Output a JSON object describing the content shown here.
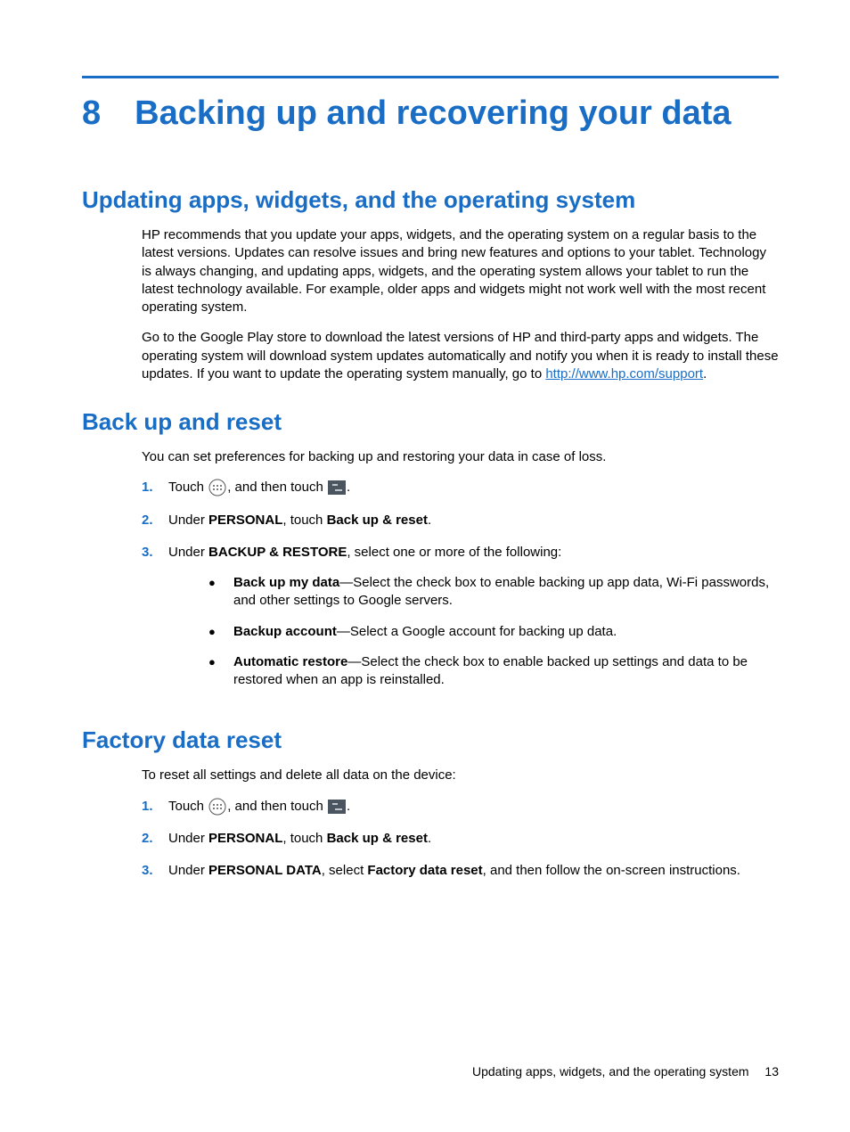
{
  "chapter": {
    "number": "8",
    "title": "Backing up and recovering your data"
  },
  "section1": {
    "heading": "Updating apps, widgets, and the operating system",
    "p1": "HP recommends that you update your apps, widgets, and the operating system on a regular basis to the latest versions. Updates can resolve issues and bring new features and options to your tablet. Technology is always changing, and updating apps, widgets, and the operating system allows your tablet to run the latest technology available. For example, older apps and widgets might not work well with the most recent operating system.",
    "p2a": "Go to the Google Play store to download the latest versions of HP and third-party apps and widgets. The operating system will download system updates automatically and notify you when it is ready to install these updates. If you want to update the operating system manually, go to ",
    "link": "http://www.hp.com/support",
    "p2b": "."
  },
  "section2": {
    "heading": "Back up and reset",
    "intro": "You can set preferences for backing up and restoring your data in case of loss.",
    "steps": {
      "s1a": "Touch ",
      "s1b": ", and then touch ",
      "s1c": ".",
      "s2a": "Under ",
      "s2b": "PERSONAL",
      "s2c": ", touch ",
      "s2d": "Back up & reset",
      "s2e": ".",
      "s3a": "Under ",
      "s3b": "BACKUP & RESTORE",
      "s3c": ", select one or more of the following:",
      "b1a": "Back up my data",
      "b1b": "—Select the check box to enable backing up app data, Wi-Fi passwords, and other settings to Google servers.",
      "b2a": "Backup account",
      "b2b": "—Select a Google account for backing up data.",
      "b3a": "Automatic restore",
      "b3b": "—Select the check box to enable backed up settings and data to be restored when an app is reinstalled."
    },
    "nums": {
      "n1": "1.",
      "n2": "2.",
      "n3": "3."
    },
    "bullet": "●"
  },
  "section3": {
    "heading": "Factory data reset",
    "intro": "To reset all settings and delete all data on the device:",
    "steps": {
      "s1a": "Touch ",
      "s1b": ", and then touch ",
      "s1c": ".",
      "s2a": "Under ",
      "s2b": "PERSONAL",
      "s2c": ", touch ",
      "s2d": "Back up & reset",
      "s2e": ".",
      "s3a": "Under ",
      "s3b": "PERSONAL DATA",
      "s3c": ", select ",
      "s3d": "Factory data reset",
      "s3e": ", and then follow the on-screen instructions."
    }
  },
  "footer": {
    "text": "Updating apps, widgets, and the operating system",
    "page": "13"
  }
}
